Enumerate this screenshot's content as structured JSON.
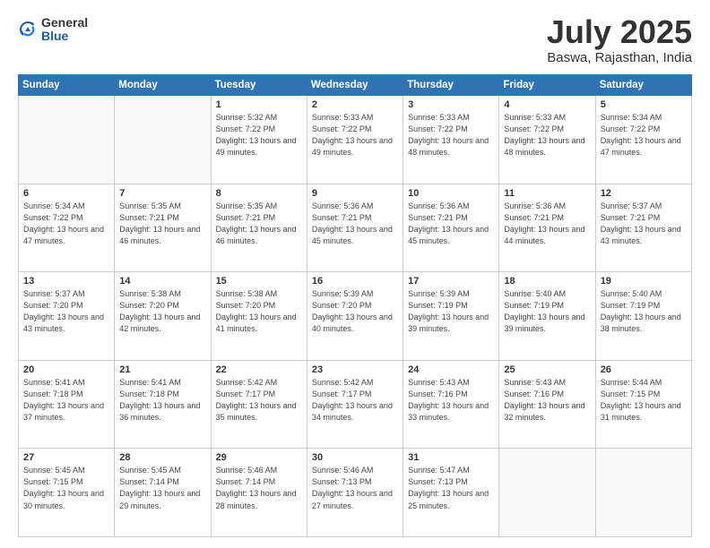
{
  "header": {
    "logo_general": "General",
    "logo_blue": "Blue",
    "month": "July 2025",
    "location": "Baswa, Rajasthan, India"
  },
  "weekdays": [
    "Sunday",
    "Monday",
    "Tuesday",
    "Wednesday",
    "Thursday",
    "Friday",
    "Saturday"
  ],
  "weeks": [
    [
      {
        "day": "",
        "info": ""
      },
      {
        "day": "",
        "info": ""
      },
      {
        "day": "1",
        "info": "Sunrise: 5:32 AM\nSunset: 7:22 PM\nDaylight: 13 hours and 49 minutes."
      },
      {
        "day": "2",
        "info": "Sunrise: 5:33 AM\nSunset: 7:22 PM\nDaylight: 13 hours and 49 minutes."
      },
      {
        "day": "3",
        "info": "Sunrise: 5:33 AM\nSunset: 7:22 PM\nDaylight: 13 hours and 48 minutes."
      },
      {
        "day": "4",
        "info": "Sunrise: 5:33 AM\nSunset: 7:22 PM\nDaylight: 13 hours and 48 minutes."
      },
      {
        "day": "5",
        "info": "Sunrise: 5:34 AM\nSunset: 7:22 PM\nDaylight: 13 hours and 47 minutes."
      }
    ],
    [
      {
        "day": "6",
        "info": "Sunrise: 5:34 AM\nSunset: 7:22 PM\nDaylight: 13 hours and 47 minutes."
      },
      {
        "day": "7",
        "info": "Sunrise: 5:35 AM\nSunset: 7:21 PM\nDaylight: 13 hours and 46 minutes."
      },
      {
        "day": "8",
        "info": "Sunrise: 5:35 AM\nSunset: 7:21 PM\nDaylight: 13 hours and 46 minutes."
      },
      {
        "day": "9",
        "info": "Sunrise: 5:36 AM\nSunset: 7:21 PM\nDaylight: 13 hours and 45 minutes."
      },
      {
        "day": "10",
        "info": "Sunrise: 5:36 AM\nSunset: 7:21 PM\nDaylight: 13 hours and 45 minutes."
      },
      {
        "day": "11",
        "info": "Sunrise: 5:36 AM\nSunset: 7:21 PM\nDaylight: 13 hours and 44 minutes."
      },
      {
        "day": "12",
        "info": "Sunrise: 5:37 AM\nSunset: 7:21 PM\nDaylight: 13 hours and 43 minutes."
      }
    ],
    [
      {
        "day": "13",
        "info": "Sunrise: 5:37 AM\nSunset: 7:20 PM\nDaylight: 13 hours and 43 minutes."
      },
      {
        "day": "14",
        "info": "Sunrise: 5:38 AM\nSunset: 7:20 PM\nDaylight: 13 hours and 42 minutes."
      },
      {
        "day": "15",
        "info": "Sunrise: 5:38 AM\nSunset: 7:20 PM\nDaylight: 13 hours and 41 minutes."
      },
      {
        "day": "16",
        "info": "Sunrise: 5:39 AM\nSunset: 7:20 PM\nDaylight: 13 hours and 40 minutes."
      },
      {
        "day": "17",
        "info": "Sunrise: 5:39 AM\nSunset: 7:19 PM\nDaylight: 13 hours and 39 minutes."
      },
      {
        "day": "18",
        "info": "Sunrise: 5:40 AM\nSunset: 7:19 PM\nDaylight: 13 hours and 39 minutes."
      },
      {
        "day": "19",
        "info": "Sunrise: 5:40 AM\nSunset: 7:19 PM\nDaylight: 13 hours and 38 minutes."
      }
    ],
    [
      {
        "day": "20",
        "info": "Sunrise: 5:41 AM\nSunset: 7:18 PM\nDaylight: 13 hours and 37 minutes."
      },
      {
        "day": "21",
        "info": "Sunrise: 5:41 AM\nSunset: 7:18 PM\nDaylight: 13 hours and 36 minutes."
      },
      {
        "day": "22",
        "info": "Sunrise: 5:42 AM\nSunset: 7:17 PM\nDaylight: 13 hours and 35 minutes."
      },
      {
        "day": "23",
        "info": "Sunrise: 5:42 AM\nSunset: 7:17 PM\nDaylight: 13 hours and 34 minutes."
      },
      {
        "day": "24",
        "info": "Sunrise: 5:43 AM\nSunset: 7:16 PM\nDaylight: 13 hours and 33 minutes."
      },
      {
        "day": "25",
        "info": "Sunrise: 5:43 AM\nSunset: 7:16 PM\nDaylight: 13 hours and 32 minutes."
      },
      {
        "day": "26",
        "info": "Sunrise: 5:44 AM\nSunset: 7:15 PM\nDaylight: 13 hours and 31 minutes."
      }
    ],
    [
      {
        "day": "27",
        "info": "Sunrise: 5:45 AM\nSunset: 7:15 PM\nDaylight: 13 hours and 30 minutes."
      },
      {
        "day": "28",
        "info": "Sunrise: 5:45 AM\nSunset: 7:14 PM\nDaylight: 13 hours and 29 minutes."
      },
      {
        "day": "29",
        "info": "Sunrise: 5:46 AM\nSunset: 7:14 PM\nDaylight: 13 hours and 28 minutes."
      },
      {
        "day": "30",
        "info": "Sunrise: 5:46 AM\nSunset: 7:13 PM\nDaylight: 13 hours and 27 minutes."
      },
      {
        "day": "31",
        "info": "Sunrise: 5:47 AM\nSunset: 7:13 PM\nDaylight: 13 hours and 25 minutes."
      },
      {
        "day": "",
        "info": ""
      },
      {
        "day": "",
        "info": ""
      }
    ]
  ]
}
